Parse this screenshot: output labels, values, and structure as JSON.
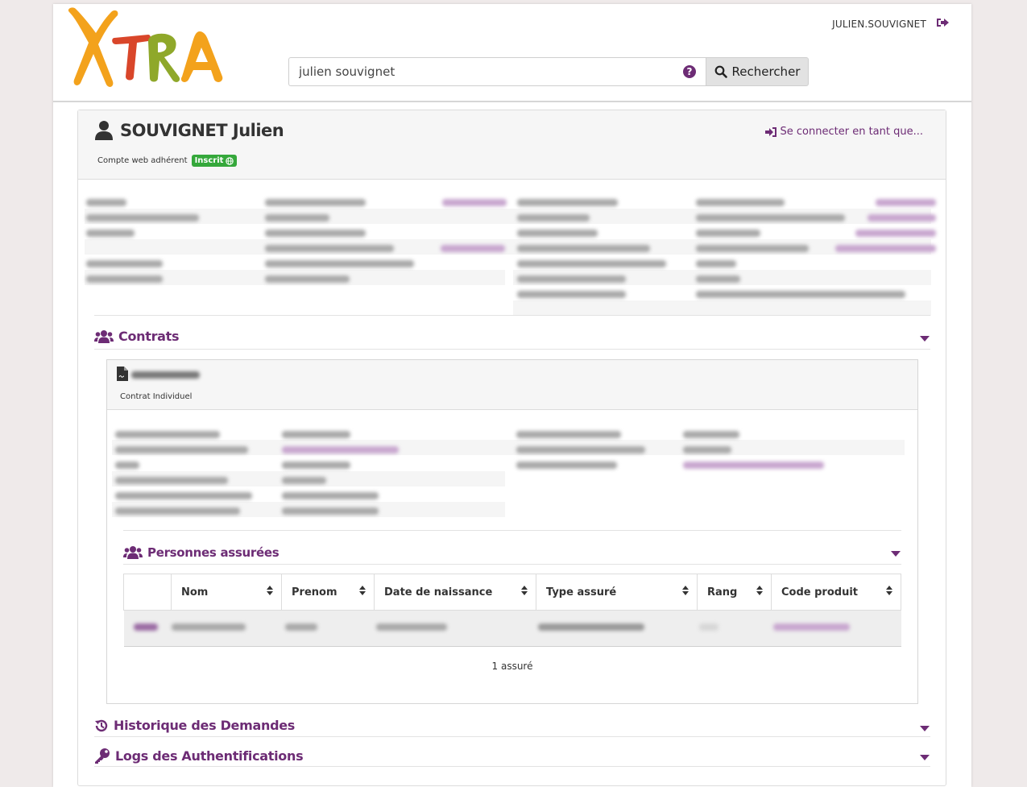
{
  "header": {
    "logo_text": "XTRA",
    "user_name": "JULIEN.SOUVIGNET",
    "search_value": "julien souvignet",
    "search_button_label": "Rechercher"
  },
  "profile": {
    "name": "SOUVIGNET Julien",
    "web_account_label": "Compte web adhérent",
    "web_account_status": "Inscrit",
    "impersonate_label": "Se connecter en tant que..."
  },
  "sections": {
    "contracts_title": "Contrats",
    "history_title": "Historique des Demandes",
    "auth_logs_title": "Logs des Authentifications"
  },
  "contract": {
    "type_label": "Contrat Individuel",
    "insured_title": "Personnes assurées",
    "columns": [
      "Nom",
      "Prenom",
      "Date de naissance",
      "Type assuré",
      "Rang",
      "Code produit"
    ],
    "insured_count_label": "1 assuré"
  },
  "colors": {
    "accent": "#6d2c75",
    "badge_green": "#35a83b"
  }
}
